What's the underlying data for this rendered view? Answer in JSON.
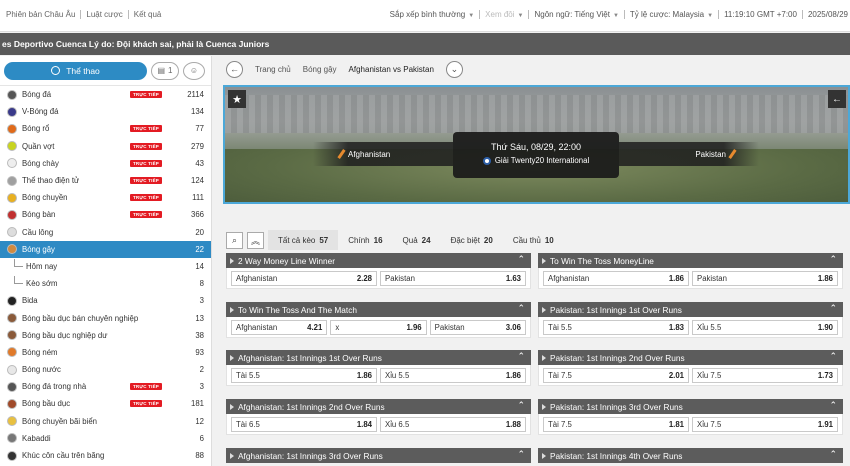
{
  "topbar": {
    "links": [
      "Phiên bản Châu Âu",
      "Luật cược",
      "Kết quả"
    ],
    "sort": "Sắp xếp bình thường",
    "view": "Xem đôi",
    "language_label": "Ngôn ngữ:",
    "language": "Tiếng Việt",
    "odds_label": "Tỷ lệ cược:",
    "odds": "Malaysia",
    "time": "11:19:10 GMT +7:00",
    "date": "2025/08/29"
  },
  "ticker": "es Deportivo Cuenca Lý do: Đội khách sai, phải là Cuenca Juniors",
  "sidebar": {
    "sports_button": "Thể thao",
    "bet_count": "1",
    "live_badge": "TRỰC TIẾP",
    "items": [
      {
        "label": "Bóng đá",
        "count": "2114",
        "live": true,
        "color": "#555555"
      },
      {
        "label": "V-Bóng đá",
        "count": "134",
        "live": false,
        "color": "#3a3a8a"
      },
      {
        "label": "Bóng rổ",
        "count": "77",
        "live": true,
        "color": "#e06a1a"
      },
      {
        "label": "Quần vợt",
        "count": "279",
        "live": true,
        "color": "#c8d420"
      },
      {
        "label": "Bóng chày",
        "count": "43",
        "live": true,
        "color": "#eeeeee"
      },
      {
        "label": "Thể thao điện tử",
        "count": "124",
        "live": true,
        "color": "#a0a0a0"
      },
      {
        "label": "Bóng chuyền",
        "count": "111",
        "live": true,
        "color": "#e8b020"
      },
      {
        "label": "Bóng bàn",
        "count": "366",
        "live": true,
        "color": "#c03030"
      },
      {
        "label": "Cầu lông",
        "count": "20",
        "live": false,
        "color": "#dddddd"
      },
      {
        "label": "Bóng gậy",
        "count": "22",
        "live": false,
        "color": "#d08a40",
        "active": true
      },
      {
        "label": "Hôm nay",
        "count": "14",
        "live": false,
        "sub": true
      },
      {
        "label": "Kèo sớm",
        "count": "8",
        "live": false,
        "sub": true
      },
      {
        "label": "Bida",
        "count": "3",
        "live": false,
        "color": "#222222"
      },
      {
        "label": "Bóng bầu dục bán chuyên nghiệp",
        "count": "13",
        "live": false,
        "color": "#8a5a3a"
      },
      {
        "label": "Bóng bầu dục nghiệp dư",
        "count": "38",
        "live": false,
        "color": "#8a5a3a"
      },
      {
        "label": "Bóng ném",
        "count": "93",
        "live": false,
        "color": "#e07a2a"
      },
      {
        "label": "Bóng nước",
        "count": "2",
        "live": false,
        "color": "#e8e8e8"
      },
      {
        "label": "Bóng đá trong nhà",
        "count": "3",
        "live": true,
        "color": "#555555"
      },
      {
        "label": "Bóng bầu dục",
        "count": "181",
        "live": true,
        "color": "#a04a2a"
      },
      {
        "label": "Bóng chuyền bãi biển",
        "count": "12",
        "live": false,
        "color": "#e8c040"
      },
      {
        "label": "Kabaddi",
        "count": "6",
        "live": false,
        "color": "#777777"
      },
      {
        "label": "Khúc côn cầu trên băng",
        "count": "88",
        "live": false,
        "color": "#333333"
      }
    ]
  },
  "breadcrumb": {
    "home": "Trang chủ",
    "sport": "Bóng gậy",
    "match": "Afghanistan vs Pakistan"
  },
  "match": {
    "home": "Afghanistan",
    "away": "Pakistan",
    "datetime": "Thứ Sáu, 08/29, 22:00",
    "league": "Giải Twenty20 International"
  },
  "tabs": [
    {
      "label": "Tất cả kèo",
      "count": "57",
      "active": true
    },
    {
      "label": "Chính",
      "count": "16"
    },
    {
      "label": "Quả",
      "count": "24"
    },
    {
      "label": "Đặc biệt",
      "count": "20"
    },
    {
      "label": "Cầu thủ",
      "count": "10"
    }
  ],
  "markets": [
    {
      "title": "2 Way Money Line Winner",
      "sels": [
        {
          "n": "Afghanistan",
          "o": "2.28"
        },
        {
          "n": "Pakistan",
          "o": "1.63"
        }
      ]
    },
    {
      "title": "To Win The Toss MoneyLine",
      "sels": [
        {
          "n": "Afghanistan",
          "o": "1.86"
        },
        {
          "n": "Pakistan",
          "o": "1.86"
        }
      ]
    },
    {
      "title": "To Win The Toss And The Match",
      "sels": [
        {
          "n": "Afghanistan",
          "o": "4.21"
        },
        {
          "n": "x",
          "o": "1.96"
        },
        {
          "n": "Pakistan",
          "o": "3.06"
        }
      ]
    },
    {
      "title": "Pakistan: 1st Innings 1st Over Runs",
      "sels": [
        {
          "n": "Tài 5.5",
          "o": "1.83"
        },
        {
          "n": "Xỉu 5.5",
          "o": "1.90"
        }
      ]
    },
    {
      "title": "Afghanistan: 1st Innings 1st Over Runs",
      "sels": [
        {
          "n": "Tài 5.5",
          "o": "1.86"
        },
        {
          "n": "Xỉu 5.5",
          "o": "1.86"
        }
      ]
    },
    {
      "title": "Pakistan: 1st Innings 2nd Over Runs",
      "sels": [
        {
          "n": "Tài 7.5",
          "o": "2.01"
        },
        {
          "n": "Xỉu 7.5",
          "o": "1.73"
        }
      ]
    },
    {
      "title": "Afghanistan: 1st Innings 2nd Over Runs",
      "sels": [
        {
          "n": "Tài 6.5",
          "o": "1.84"
        },
        {
          "n": "Xỉu 6.5",
          "o": "1.88"
        }
      ]
    },
    {
      "title": "Pakistan: 1st Innings 3rd Over Runs",
      "sels": [
        {
          "n": "Tài 7.5",
          "o": "1.81"
        },
        {
          "n": "Xỉu 7.5",
          "o": "1.91"
        }
      ]
    },
    {
      "title": "Afghanistan: 1st Innings 3rd Over Runs",
      "sels": []
    },
    {
      "title": "Pakistan: 1st Innings 4th Over Runs",
      "sels": []
    }
  ]
}
